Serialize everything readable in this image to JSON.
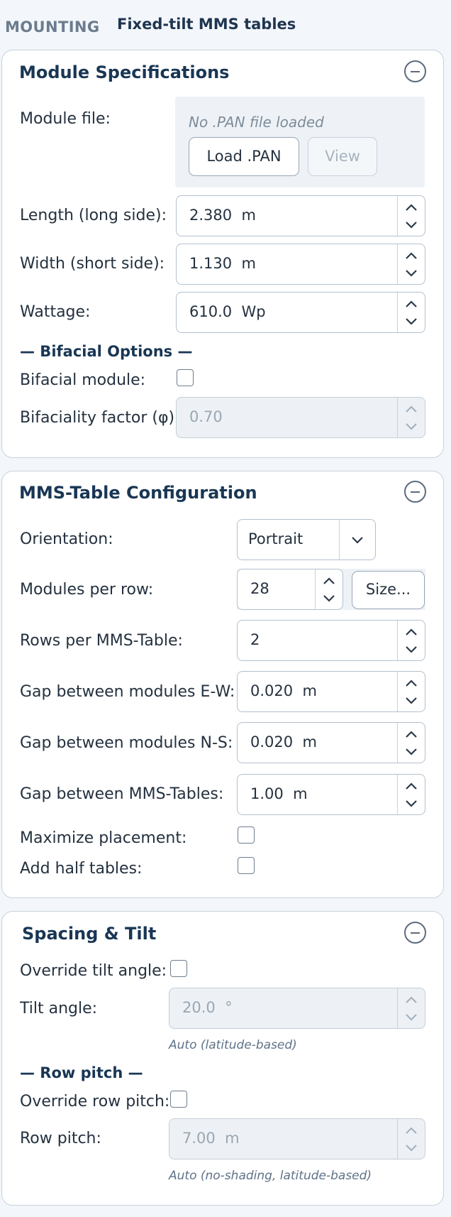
{
  "header": {
    "section_label": "MOUNTING",
    "title": "Fixed-tilt MMS tables"
  },
  "module_specs": {
    "title": "Module Specifications",
    "module_file_label": "Module file:",
    "file_status": "No .PAN file loaded",
    "load_button": "Load .PAN",
    "view_button": "View",
    "length_label": "Length (long side):",
    "length_value": "2.380  m",
    "width_label": "Width (short side):",
    "width_value": "1.130  m",
    "wattage_label": "Wattage:",
    "wattage_value": "610.0  Wp",
    "bifacial_header": "— Bifacial Options —",
    "bifacial_label": "Bifacial module:",
    "bifacial_checked": false,
    "bifaciality_label": "Bifaciality factor (φ):",
    "bifaciality_value": "0.70"
  },
  "mms_config": {
    "title": "MMS-Table Configuration",
    "orientation_label": "Orientation:",
    "orientation_value": "Portrait",
    "modules_per_row_label": "Modules per row:",
    "modules_per_row_value": "28",
    "size_button": "Size...",
    "rows_per_table_label": "Rows per MMS-Table:",
    "rows_per_table_value": "2",
    "gap_ew_label": "Gap between modules E-W:",
    "gap_ew_value": "0.020  m",
    "gap_ns_label": "Gap between modules N-S:",
    "gap_ns_value": "0.020  m",
    "gap_tables_label": "Gap between MMS-Tables:",
    "gap_tables_value": "1.00  m",
    "maximize_label": "Maximize placement:",
    "maximize_checked": false,
    "half_tables_label": "Add half tables:",
    "half_tables_checked": false
  },
  "spacing_tilt": {
    "title": "Spacing & Tilt",
    "override_tilt_label": "Override tilt angle:",
    "override_tilt_checked": false,
    "tilt_label": "Tilt angle:",
    "tilt_value": "20.0  °",
    "tilt_hint": "Auto (latitude-based)",
    "row_pitch_header": "— Row pitch —",
    "override_pitch_label": "Override row pitch:",
    "override_pitch_checked": false,
    "row_pitch_label": "Row pitch:",
    "row_pitch_value": "7.00  m",
    "row_pitch_hint": "Auto (no-shading, latitude-based)"
  },
  "colors": {
    "heading": "#193654",
    "border": "#c7d2de",
    "disabled_bg": "#edf1f5",
    "hint": "#5e7287"
  }
}
